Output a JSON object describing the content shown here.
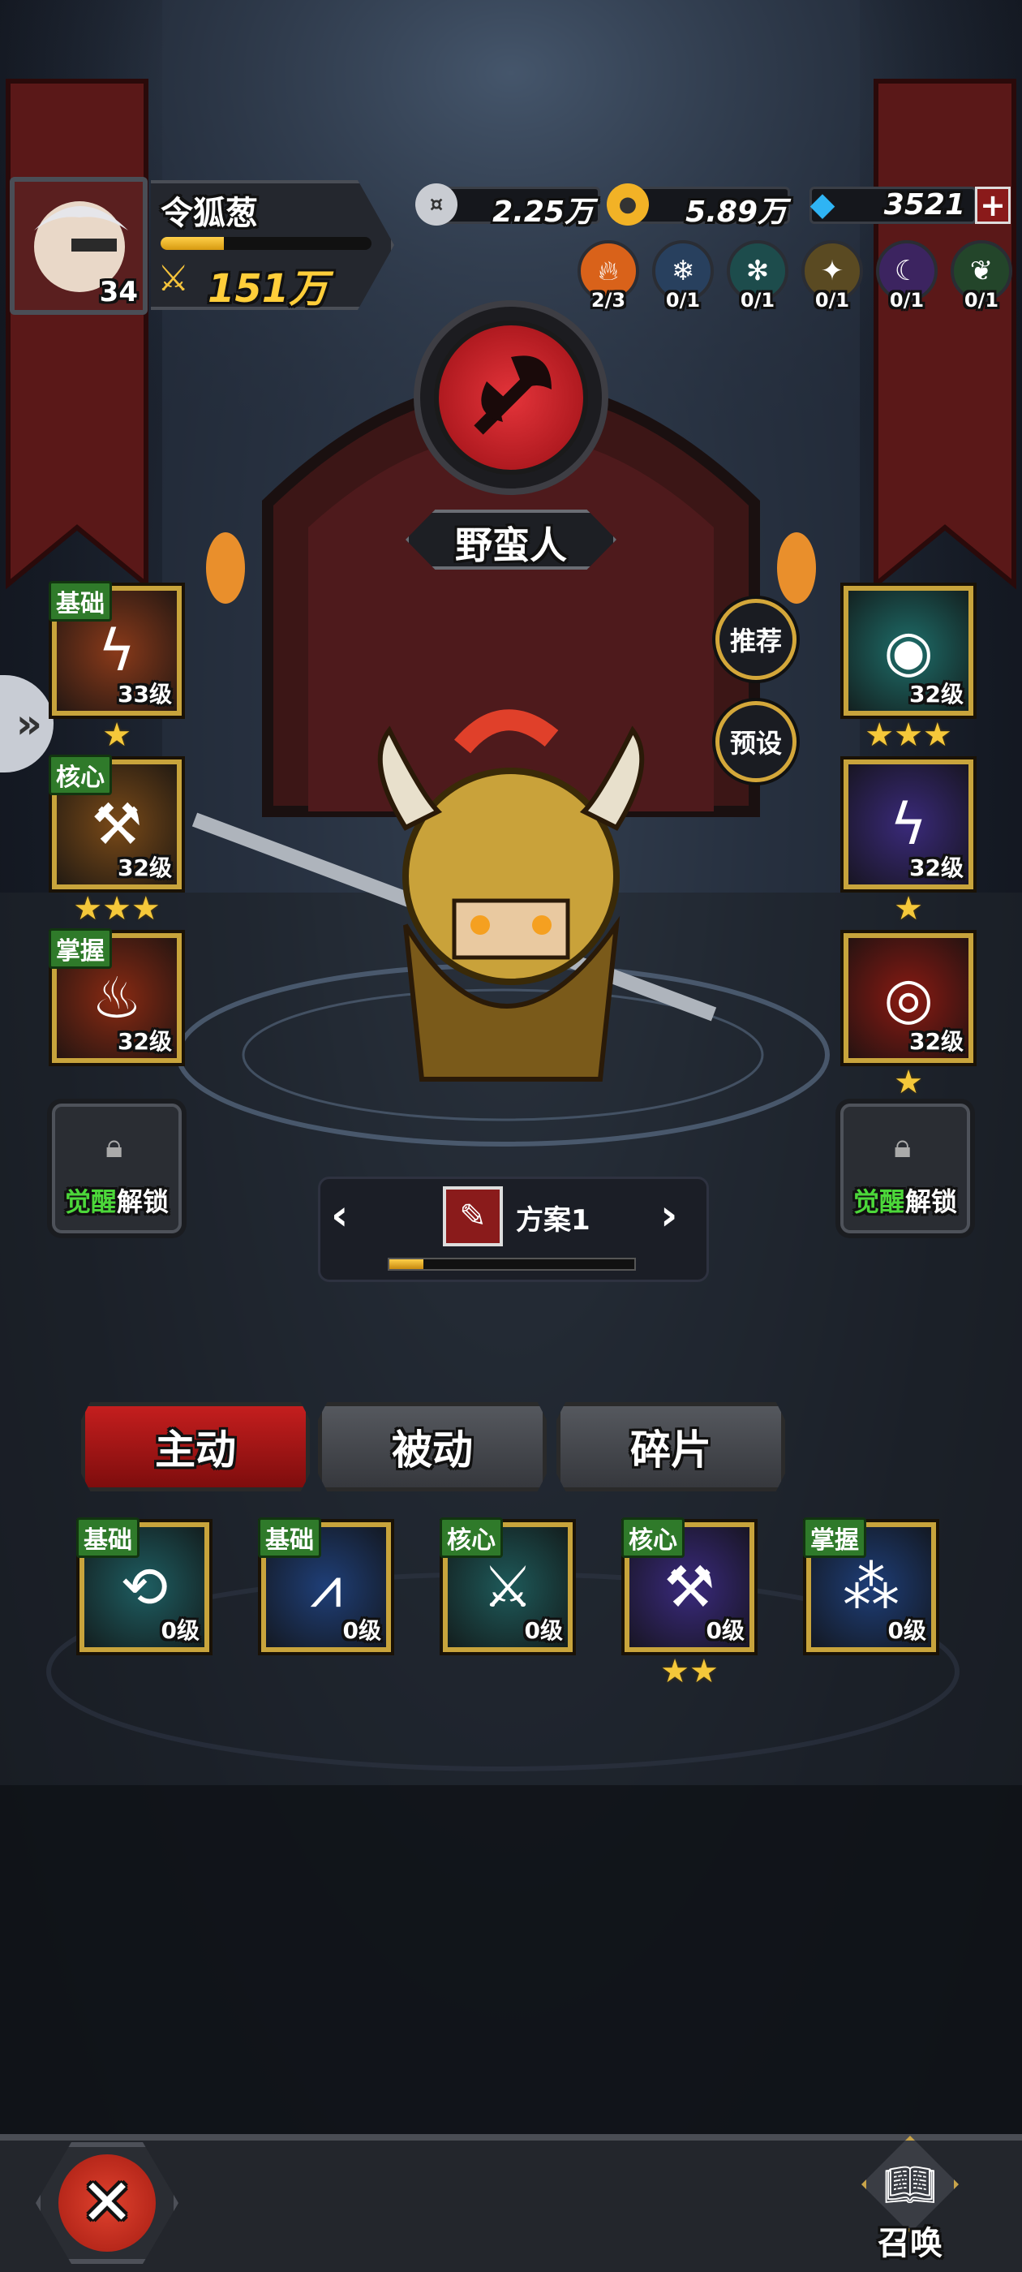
{
  "player": {
    "name": "令狐葱",
    "level": "34",
    "power": "151万",
    "exp_progress": 0.3
  },
  "currencies": [
    {
      "name": "silver",
      "icon": "silver-coin-icon",
      "value": "2.25万",
      "color": "#c9ccd2"
    },
    {
      "name": "gold",
      "icon": "gold-coin-icon",
      "value": "5.89万",
      "color": "#f2b226"
    },
    {
      "name": "diamond",
      "icon": "diamond-icon",
      "value": "3521",
      "color": "#2fb4f4"
    }
  ],
  "add_currency_label": "+",
  "elements": [
    {
      "icon": "fire-icon",
      "count": "2/3",
      "color": "#d9621a"
    },
    {
      "icon": "ice-icon",
      "count": "0/1",
      "color": "#28405e"
    },
    {
      "icon": "wind-icon",
      "count": "0/1",
      "color": "#1d4c4c"
    },
    {
      "icon": "earth-icon",
      "count": "0/1",
      "color": "#5a4a22"
    },
    {
      "icon": "shadow-icon",
      "count": "0/1",
      "color": "#3c2460"
    },
    {
      "icon": "nature-icon",
      "count": "0/1",
      "color": "#23452a"
    }
  ],
  "hero_class": {
    "name": "野蛮人",
    "icon": "axe-icon",
    "color": "#d0262c"
  },
  "buttons": {
    "recommend": "推荐",
    "preset": "预设",
    "summon": "召唤"
  },
  "left_skills": [
    {
      "tier": "基础",
      "level": "33级",
      "stars": "★",
      "icon": "claw-icon",
      "color": "#8a3a1a"
    },
    {
      "tier": "核心",
      "level": "32级",
      "stars": "★★★",
      "icon": "hammer-icon",
      "color": "#7a4a18"
    },
    {
      "tier": "掌握",
      "level": "32级",
      "stars": "",
      "icon": "flame-icon",
      "color": "#8a2a12"
    }
  ],
  "right_skills": [
    {
      "tier": "",
      "level": "32级",
      "stars": "★★★",
      "icon": "eye-icon",
      "color": "#1e6e6a"
    },
    {
      "tier": "",
      "level": "32级",
      "stars": "★",
      "icon": "lightning-icon",
      "color": "#3a2a7a"
    },
    {
      "tier": "",
      "level": "32级",
      "stars": "★",
      "icon": "vortex-icon",
      "color": "#8a1a12"
    }
  ],
  "awaken_slot": {
    "highlight": "觉醒",
    "rest": "解锁"
  },
  "preset_bar": {
    "name": "方案1",
    "progress": 0.14,
    "prev": "‹",
    "next": "›"
  },
  "tabs": [
    {
      "label": "主动",
      "active": true
    },
    {
      "label": "被动",
      "active": false
    },
    {
      "label": "碎片",
      "active": false
    }
  ],
  "skill_list": [
    {
      "tier": "基础",
      "level": "0级",
      "stars": "",
      "icon": "whirl-icon",
      "color": "#1e5e62"
    },
    {
      "tier": "基础",
      "level": "0级",
      "stars": "",
      "icon": "ice-spikes-icon",
      "color": "#1f3f78"
    },
    {
      "tier": "核心",
      "level": "0级",
      "stars": "",
      "icon": "axe-throw-icon",
      "color": "#1e5a5a"
    },
    {
      "tier": "核心",
      "level": "0级",
      "stars": "★★",
      "icon": "war-hammer-icon",
      "color": "#3a2a7e"
    },
    {
      "tier": "掌握",
      "level": "0级",
      "stars": "",
      "icon": "orbs-icon",
      "color": "#1e3e78"
    }
  ]
}
